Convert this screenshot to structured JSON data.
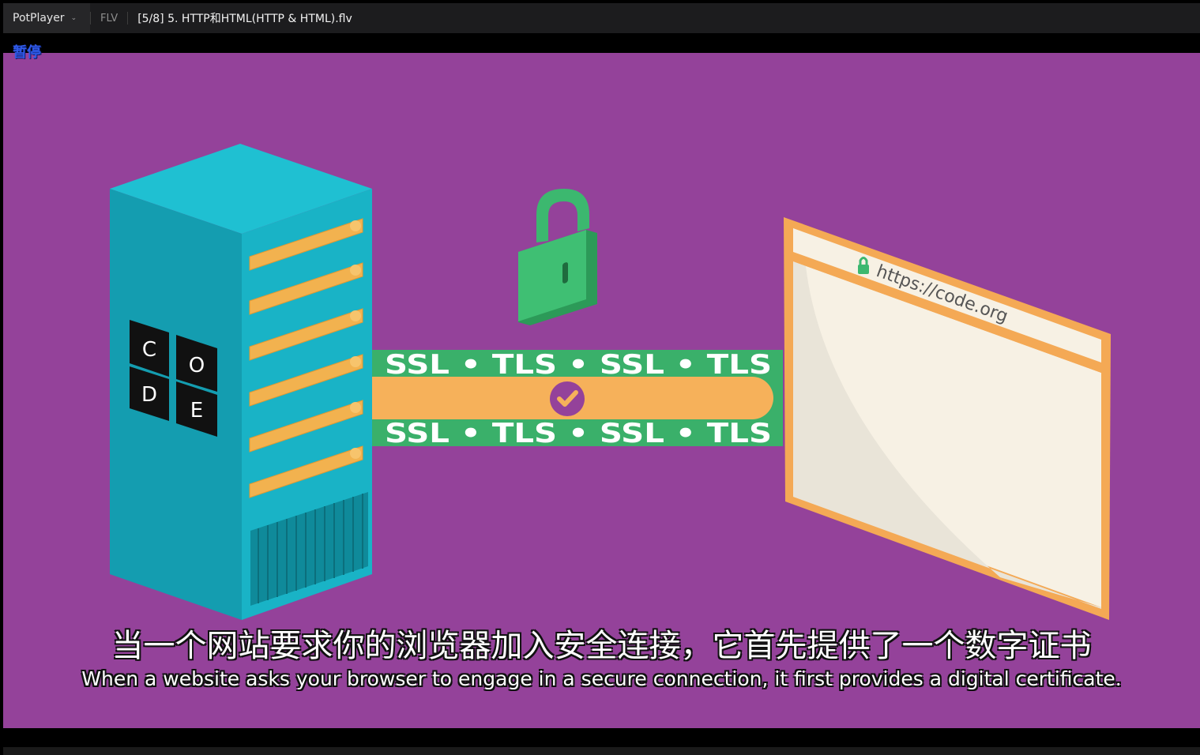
{
  "titlebar": {
    "app_name": "PotPlayer",
    "format": "FLV",
    "file_title": "[5/8] 5. HTTP和HTML(HTTP & HTML).flv"
  },
  "osd": {
    "status": "暂停"
  },
  "video": {
    "server_logo_letters": [
      "C",
      "O",
      "D",
      "E"
    ],
    "banner_top": "SSL • TLS • SSL • TLS",
    "banner_bottom": "SSL • TLS • SSL • TLS",
    "browser_url": "https://code.org",
    "colors": {
      "background": "#94429a",
      "server": "#17aebf",
      "lock": "#37b36b",
      "banner_green": "#3ab06a",
      "banner_orange": "#f6b15a",
      "browser_frame": "#f4a955"
    }
  },
  "subtitles": {
    "zh": "当一个网站要求你的浏览器加入安全连接，它首先提供了一个数字证书",
    "en": "When a website asks your browser to engage in a secure connection, it first provides a digital certificate."
  }
}
